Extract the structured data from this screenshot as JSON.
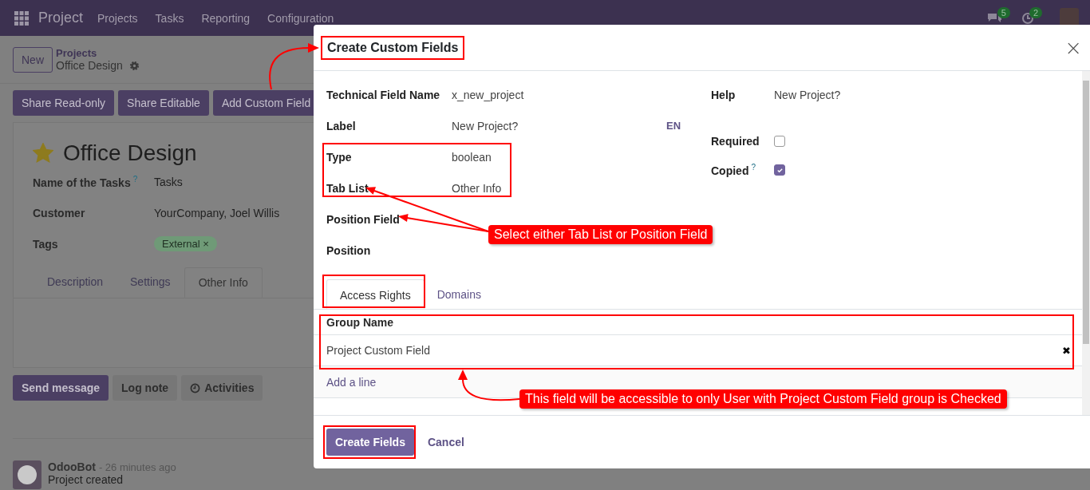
{
  "navbar": {
    "app_name": "Project",
    "menu": [
      "Projects",
      "Tasks",
      "Reporting",
      "Configuration"
    ],
    "messages_badge": "5",
    "activities_badge": "2"
  },
  "control_panel": {
    "new_button": "New",
    "breadcrumb_parent": "Projects",
    "breadcrumb_current": "Office Design"
  },
  "action_buttons": [
    "Share Read-only",
    "Share Editable",
    "Add Custom Field"
  ],
  "record": {
    "starred": true,
    "title": "Office Design",
    "fields": [
      {
        "label": "Name of the Tasks",
        "help": "?",
        "value": "Tasks",
        "kind": "text"
      },
      {
        "label": "Customer",
        "value": "YourCompany, Joel Willis",
        "kind": "text"
      },
      {
        "label": "Tags",
        "value": "External",
        "remove": "×",
        "kind": "tag"
      }
    ],
    "tabs": [
      {
        "label": "Description",
        "selected": false
      },
      {
        "label": "Settings",
        "selected": false
      },
      {
        "label": "Other Info",
        "selected": true
      }
    ]
  },
  "chatter": {
    "buttons": [
      {
        "label": "Send message",
        "kind": "primary"
      },
      {
        "label": "Log note",
        "kind": "secondary"
      },
      {
        "label": "Activities",
        "kind": "activity"
      }
    ],
    "message": {
      "author": "OdooBot",
      "time": "- 26 minutes ago",
      "body": "Project created"
    }
  },
  "dialog": {
    "title": "Create Custom Fields",
    "close": "×",
    "left_fields": [
      {
        "label": "Technical Field Name",
        "value": "x_new_project"
      },
      {
        "label": "Label",
        "value": "New Project?",
        "lang": "EN"
      },
      {
        "label": "Type",
        "value": "boolean"
      },
      {
        "label": "Tab List",
        "value": "Other Info"
      },
      {
        "label": "Position Field"
      },
      {
        "label": "Position"
      }
    ],
    "right_fields": [
      {
        "label": "Help",
        "value": "New Project?",
        "kind": "text"
      },
      {
        "label": "Required",
        "checked": false,
        "kind": "checkbox"
      },
      {
        "label": "Copied",
        "help": "?",
        "checked": true,
        "kind": "checkbox"
      }
    ],
    "tabs": [
      {
        "label": "Access Rights",
        "selected": true
      },
      {
        "label": "Domains",
        "selected": false
      }
    ],
    "table": {
      "columns": [
        "Group Name"
      ],
      "rows": [
        {
          "cells": [
            "Project Custom Field"
          ],
          "delete": "✖"
        }
      ],
      "add_line": "Add a line"
    },
    "buttons": [
      {
        "label": "Create Fields",
        "kind": "primary"
      },
      {
        "label": "Cancel",
        "kind": "link"
      }
    ]
  },
  "annotations": {
    "callouts": [
      "Select either Tab List or Position Field",
      "This field will be accessible to only User with Project Custom Field group is Checked"
    ]
  }
}
